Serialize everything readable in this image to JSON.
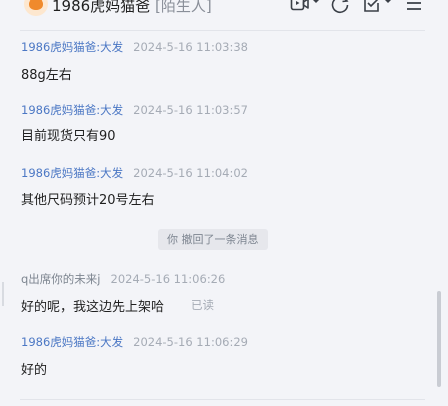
{
  "header": {
    "title": "1986虎妈猫爸",
    "tag": "[陌生人]"
  },
  "messages": [
    {
      "sender": "1986虎妈猫爸:大发",
      "time": "2024-5-16 11:03:38",
      "text": "88g左右"
    },
    {
      "sender": "1986虎妈猫爸:大发",
      "time": "2024-5-16 11:03:57",
      "text": "目前现货只有90"
    },
    {
      "sender": "1986虎妈猫爸:大发",
      "time": "2024-5-16 11:04:02",
      "text": "其他尺码预计20号左右"
    },
    {
      "sender": "q出席你的未来j",
      "time": "2024-5-16 11:06:26",
      "text": "好的呢，我这边先上架哈",
      "status": "已读"
    },
    {
      "sender": "1986虎妈猫爸:大发",
      "time": "2024-5-16 11:06:29",
      "text": "好的"
    }
  ],
  "system_notice": "你 撤回了一条消息",
  "colors": {
    "background": "#f3f4f8",
    "sender_self": "#4b77c4",
    "sender_other": "#7d8590"
  },
  "icons": [
    "avatar-icon",
    "video-call-icon",
    "chevron-down-icon",
    "history-icon",
    "task-check-icon",
    "menu-icon"
  ]
}
